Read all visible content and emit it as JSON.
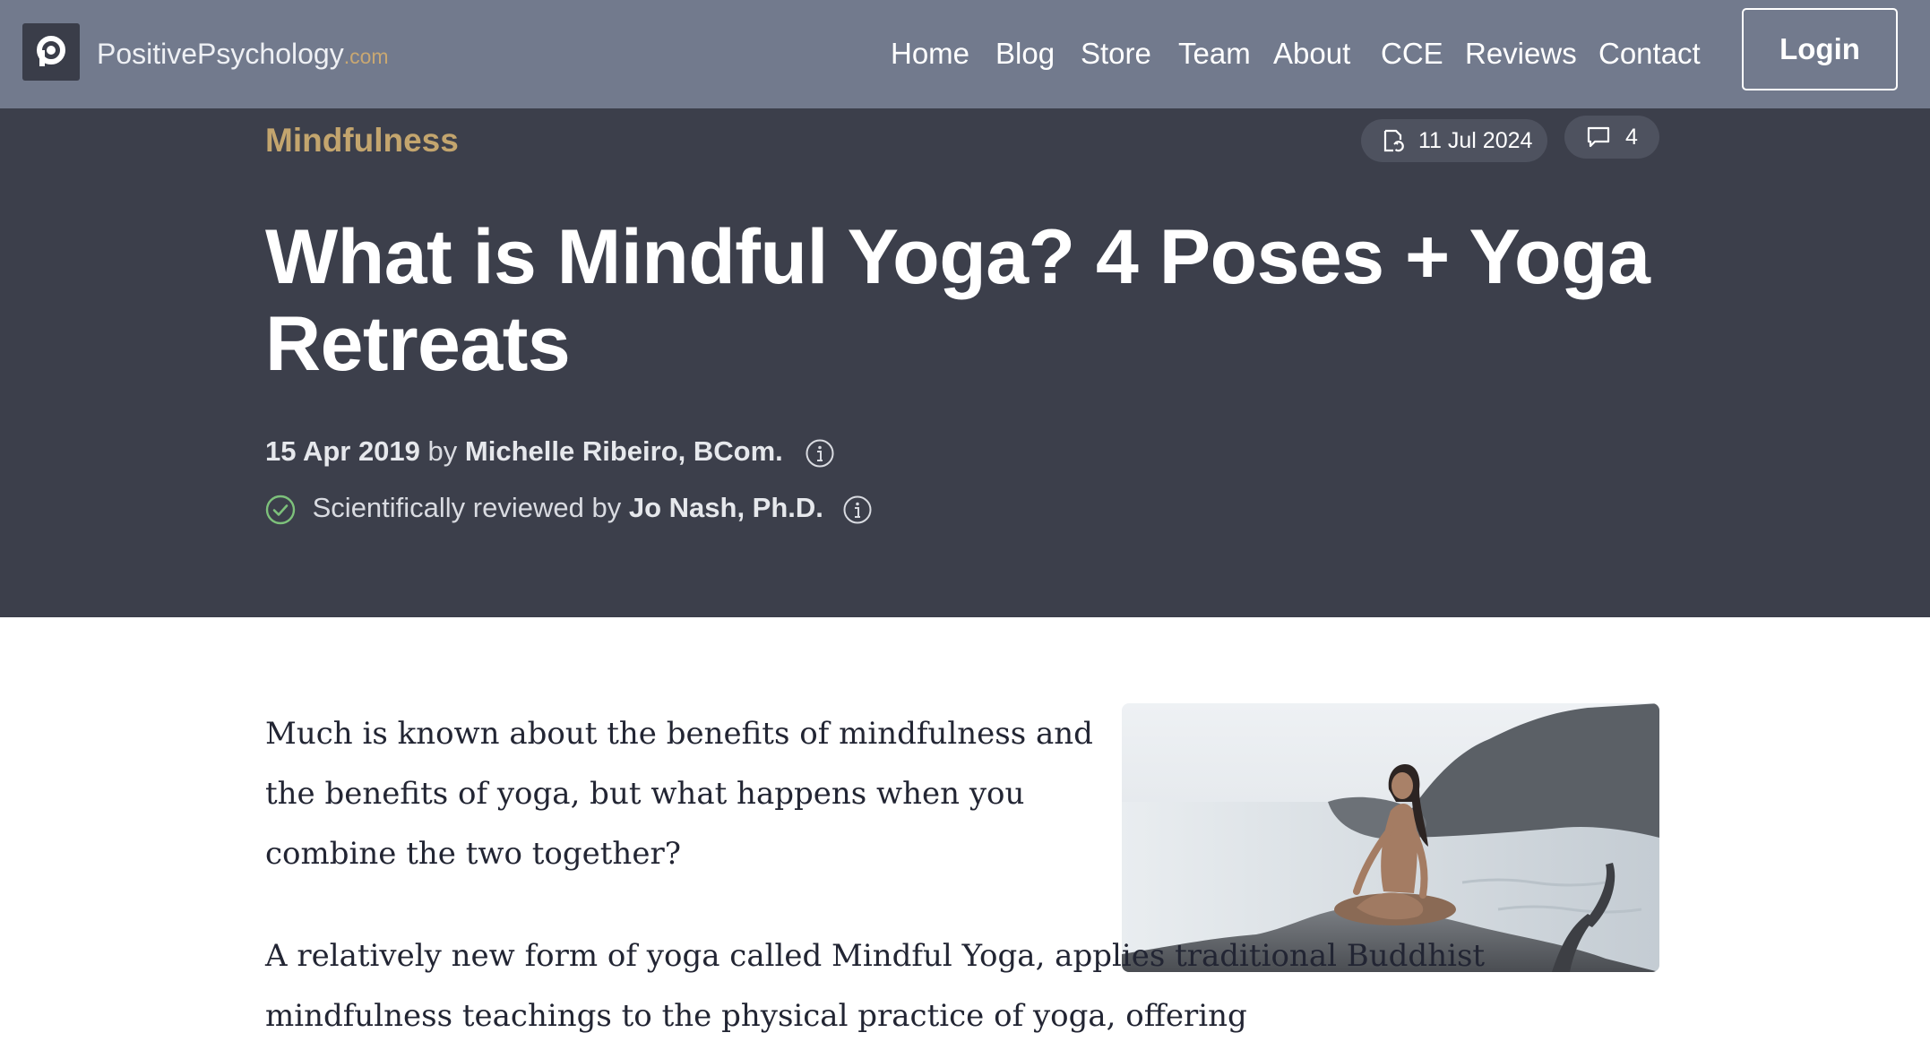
{
  "header": {
    "brand_name": "PositivePsychology",
    "brand_tld": ".com",
    "logo_letter_icon": "p-logo-icon",
    "nav": [
      {
        "label": "Home"
      },
      {
        "label": "Blog"
      },
      {
        "label": "Store"
      },
      {
        "label": "Team"
      },
      {
        "label": "About"
      },
      {
        "label": "CCE"
      },
      {
        "label": "Reviews"
      },
      {
        "label": "Contact"
      }
    ],
    "login_label": "Login"
  },
  "article": {
    "category": "Mindfulness",
    "updated_date": "11 Jul 2024",
    "comment_count": "4",
    "title": "What is Mindful Yoga? 4 Poses + Yoga Retreats",
    "published_date": "15 Apr 2019",
    "by_word": "by",
    "author": "Michelle Ribeiro, BCom.",
    "reviewed_prefix": "Scientifically reviewed by",
    "reviewer": "Jo Nash, Ph.D.",
    "paragraphs": [
      "Much is known about the benefits of mindfulness and the benefits of yoga, but what happens when you combine the two together?",
      "A relatively new form of yoga called Mindful Yoga, applies traditional Buddhist mindfulness teachings to the physical practice of yoga, offering"
    ]
  },
  "colors": {
    "nav_bg": "#727a8d",
    "hero_bg": "#3c3f4b",
    "category_accent": "#c3a56e",
    "check_green": "#7dc17b"
  }
}
